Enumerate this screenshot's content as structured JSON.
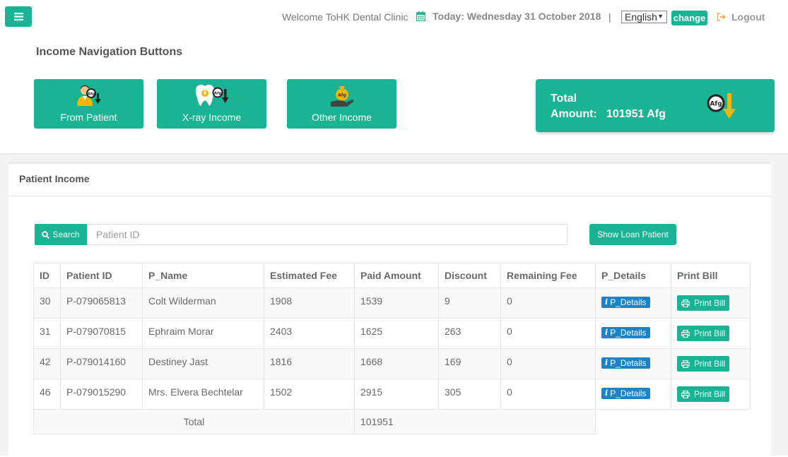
{
  "header": {
    "welcome": "Welcome ToHK Dental Clinic",
    "today": "Today: Wednesday 31 October 2018",
    "separator": "|",
    "language": "English",
    "change_label": "change",
    "logout_label": "Logout"
  },
  "income_nav": {
    "title": "Income Navigation Buttons",
    "buttons": [
      {
        "label": "From Patient",
        "icon": "patient-afg-icon"
      },
      {
        "label": "X-ray Income",
        "icon": "tooth-xray-icon"
      },
      {
        "label": "Other Income",
        "icon": "money-bag-hand-icon"
      }
    ],
    "total_label": "Total",
    "amount_label": "Amount:",
    "amount_value": "101951 Afg"
  },
  "panel": {
    "title": "Patient Income",
    "search_label": "Search",
    "search_placeholder": "Patient ID",
    "loan_button": "Show Loan Patient"
  },
  "table": {
    "columns": [
      "ID",
      "Patient ID",
      "P_Name",
      "Estimated Fee",
      "Paid Amount",
      "Discount",
      "Remaining Fee",
      "P_Details",
      "Print Bill"
    ],
    "rows": [
      {
        "id": "30",
        "patient_id": "P-079065813",
        "name": "Colt Wilderman",
        "estimated": "1908",
        "paid": "1539",
        "discount": "9",
        "remaining": "0",
        "details": "P_Details",
        "print": "Print Bill"
      },
      {
        "id": "31",
        "patient_id": "P-079070815",
        "name": "Ephraim Morar",
        "estimated": "2403",
        "paid": "1625",
        "discount": "263",
        "remaining": "0",
        "details": "P_Details",
        "print": "Print Bill"
      },
      {
        "id": "42",
        "patient_id": "P-079014160",
        "name": "Destiney Jast",
        "estimated": "1816",
        "paid": "1668",
        "discount": "169",
        "remaining": "0",
        "details": "P_Details",
        "print": "Print Bill"
      },
      {
        "id": "46",
        "patient_id": "P-079015290",
        "name": "Mrs. Elvera Bechtelar",
        "estimated": "1502",
        "paid": "2915",
        "discount": "305",
        "remaining": "0",
        "details": "P_Details",
        "print": "Print Bill"
      }
    ],
    "total_label": "Total",
    "total_value": "101951"
  },
  "colors": {
    "accent": "#1ab394",
    "info": "#1c84c6",
    "text": "#676a6c"
  }
}
